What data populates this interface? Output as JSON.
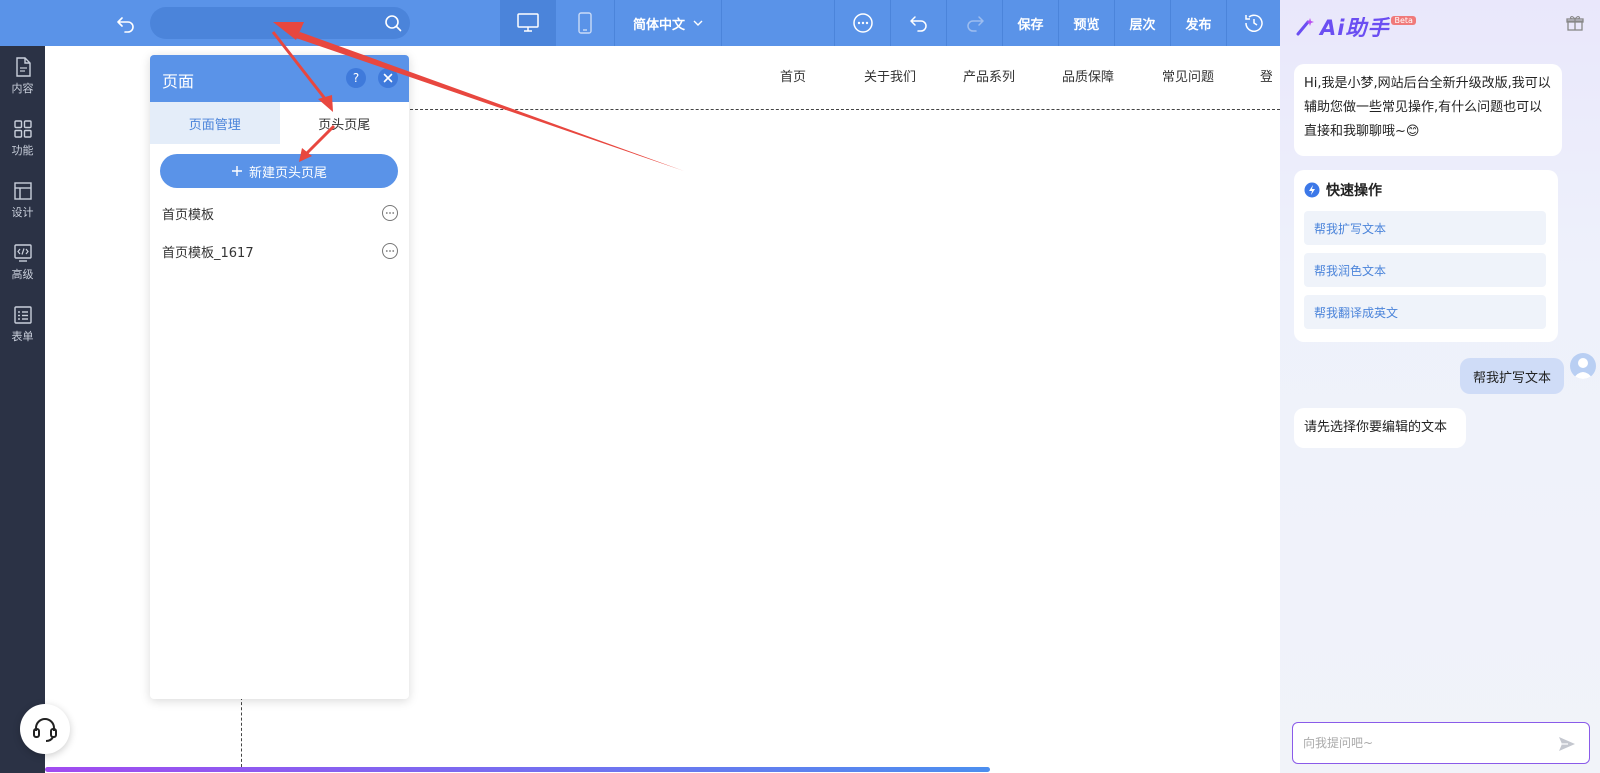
{
  "toolbar": {
    "search_placeholder": "",
    "language": "简体中文",
    "save": "保存",
    "preview": "预览",
    "layers": "层次",
    "publish": "发布"
  },
  "sidebar": {
    "items": [
      {
        "label": "内容",
        "icon": "document-icon"
      },
      {
        "label": "功能",
        "icon": "grid-icon"
      },
      {
        "label": "设计",
        "icon": "layout-icon"
      },
      {
        "label": "高级",
        "icon": "code-icon"
      },
      {
        "label": "表单",
        "icon": "form-icon"
      }
    ]
  },
  "canvas": {
    "nav": [
      "首页",
      "关于我们",
      "产品系列",
      "品质保障",
      "常见问题",
      "登"
    ]
  },
  "panel": {
    "title": "页面",
    "help": "?",
    "tabs": [
      "页面管理",
      "页头页尾"
    ],
    "new_button": "新建页头页尾",
    "items": [
      "首页模板",
      "首页模板_1617"
    ]
  },
  "ai": {
    "logo": "Ai助手",
    "beta": "Beta",
    "greeting": "Hi,我是小梦,网站后台全新升级改版,我可以辅助您做一些常见操作,有什么问题也可以直接和我聊聊哦~😊",
    "quick_title": "快速操作",
    "quick_items": [
      "帮我扩写文本",
      "帮我润色文本",
      "帮我翻译成英文"
    ],
    "user_message": "帮我扩写文本",
    "reply": "请先选择你要编辑的文本",
    "input_placeholder": "向我提问吧~"
  },
  "colors": {
    "toolbar": "#5a93e8",
    "sidebar": "#2b3245",
    "accent": "#4b84da",
    "annotation": "#e8473f"
  }
}
